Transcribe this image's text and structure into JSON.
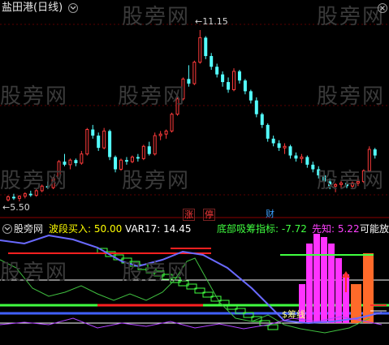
{
  "header": {
    "title": "盐田港(日线)",
    "title_color": "#e6e6e6"
  },
  "main_chart": {
    "high_label": "11.15",
    "low_label": "5.50",
    "high_arrow": "←",
    "low_arrow": "←",
    "tags": [
      {
        "text": "涨",
        "color": "#ff3b3b"
      },
      {
        "text": "停",
        "color": "#ff3b3b"
      },
      {
        "text": "财",
        "color": "#3aa0ff"
      }
    ],
    "up_color": "#ff3b3b",
    "down_color": "#54ffff"
  },
  "indicator": {
    "name": "股旁网",
    "items": [
      {
        "label": "波段买入: 50.00",
        "color": "#ffff00"
      },
      {
        "label": "VAR17: 14.45",
        "color": "#ffffff"
      },
      {
        "label": "底部吸筹指标: -7.72",
        "color": "#40ff40"
      },
      {
        "label": "先知: 5.22",
        "color": "#ff40ff"
      },
      {
        "label": "可能放",
        "color": "#ffffff"
      }
    ],
    "annotation": "$筹线"
  },
  "watermark": "股旁网",
  "candles": [
    [
      5.6,
      5.75,
      5.55,
      5.7
    ],
    [
      5.7,
      5.8,
      5.6,
      5.65
    ],
    [
      5.65,
      5.75,
      5.55,
      5.72
    ],
    [
      5.72,
      5.85,
      5.65,
      5.8
    ],
    [
      5.8,
      5.9,
      5.7,
      5.75
    ],
    [
      5.75,
      5.95,
      5.7,
      5.9
    ],
    [
      5.9,
      6.1,
      5.85,
      6.05
    ],
    [
      6.05,
      6.2,
      5.95,
      6.0
    ],
    [
      6.0,
      6.35,
      5.95,
      6.3
    ],
    [
      6.3,
      6.9,
      6.25,
      6.85
    ],
    [
      6.85,
      7.1,
      6.7,
      6.75
    ],
    [
      6.75,
      6.95,
      6.6,
      6.9
    ],
    [
      6.9,
      6.95,
      6.7,
      6.8
    ],
    [
      6.8,
      7.2,
      6.75,
      7.1
    ],
    [
      7.1,
      7.95,
      7.05,
      7.9
    ],
    [
      7.9,
      8.05,
      7.6,
      7.7
    ],
    [
      7.7,
      7.8,
      7.2,
      7.3
    ],
    [
      7.3,
      7.95,
      7.25,
      7.85
    ],
    [
      7.85,
      7.9,
      6.9,
      7.0
    ],
    [
      7.0,
      7.05,
      6.5,
      6.6
    ],
    [
      6.6,
      6.95,
      6.55,
      6.9
    ],
    [
      6.9,
      7.0,
      6.75,
      6.85
    ],
    [
      6.85,
      7.05,
      6.8,
      7.0
    ],
    [
      7.0,
      7.1,
      6.85,
      6.95
    ],
    [
      6.95,
      7.4,
      6.9,
      7.35
    ],
    [
      7.35,
      7.5,
      7.05,
      7.1
    ],
    [
      7.1,
      7.8,
      7.05,
      7.7
    ],
    [
      7.7,
      7.85,
      7.55,
      7.75
    ],
    [
      7.75,
      7.9,
      7.6,
      7.85
    ],
    [
      7.85,
      8.45,
      7.8,
      8.4
    ],
    [
      8.4,
      8.95,
      8.35,
      8.9
    ],
    [
      8.9,
      9.6,
      8.85,
      9.55
    ],
    [
      9.55,
      10.0,
      9.3,
      9.4
    ],
    [
      9.4,
      10.15,
      9.35,
      10.1
    ],
    [
      10.1,
      11.15,
      10.05,
      10.9
    ],
    [
      10.9,
      10.95,
      10.2,
      10.3
    ],
    [
      10.3,
      10.4,
      9.85,
      9.95
    ],
    [
      9.95,
      10.05,
      9.6,
      9.7
    ],
    [
      9.7,
      9.8,
      9.3,
      9.45
    ],
    [
      9.45,
      9.6,
      9.1,
      9.2
    ],
    [
      9.2,
      9.9,
      9.15,
      9.8
    ],
    [
      9.8,
      9.85,
      9.4,
      9.5
    ],
    [
      9.5,
      9.55,
      9.05,
      9.15
    ],
    [
      9.15,
      9.2,
      8.75,
      8.85
    ],
    [
      8.85,
      8.95,
      8.3,
      8.4
    ],
    [
      8.4,
      8.45,
      7.95,
      8.05
    ],
    [
      8.05,
      8.1,
      7.5,
      7.6
    ],
    [
      7.6,
      7.7,
      7.35,
      7.45
    ],
    [
      7.45,
      7.55,
      7.2,
      7.3
    ],
    [
      7.3,
      7.45,
      7.1,
      7.35
    ],
    [
      7.35,
      7.4,
      6.95,
      7.05
    ],
    [
      7.05,
      7.15,
      6.85,
      6.95
    ],
    [
      6.95,
      7.1,
      6.8,
      7.0
    ],
    [
      7.0,
      7.05,
      6.65,
      6.75
    ],
    [
      6.75,
      6.85,
      6.5,
      6.6
    ],
    [
      6.6,
      6.7,
      6.3,
      6.4
    ],
    [
      6.4,
      6.5,
      6.1,
      6.2
    ],
    [
      6.2,
      6.3,
      5.95,
      6.05
    ],
    [
      6.05,
      6.15,
      5.85,
      6.1
    ],
    [
      6.1,
      6.25,
      6.0,
      6.15
    ],
    [
      6.15,
      6.25,
      5.98,
      6.05
    ],
    [
      6.05,
      6.2,
      5.95,
      6.15
    ],
    [
      6.15,
      6.3,
      6.05,
      6.2
    ],
    [
      6.2,
      6.6,
      6.15,
      6.55
    ],
    [
      6.55,
      7.35,
      6.5,
      7.25
    ],
    [
      7.25,
      7.3,
      6.95,
      7.05
    ]
  ]
}
